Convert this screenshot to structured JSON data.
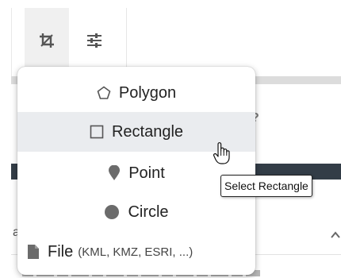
{
  "toolbar": {
    "buttons": [
      {
        "icon": "crop-icon"
      },
      {
        "icon": "sliders-icon"
      }
    ]
  },
  "menu": {
    "items": [
      {
        "label": "Polygon",
        "icon": "polygon-icon"
      },
      {
        "label": "Rectangle",
        "icon": "square-icon",
        "hovered": true
      },
      {
        "label": "Point",
        "icon": "map-pin-icon"
      },
      {
        "label": "Circle",
        "icon": "circle-icon"
      },
      {
        "label": "File",
        "sublabel": "(KML, KMZ, ESRI, ...)",
        "icon": "file-icon"
      }
    ]
  },
  "tooltip": {
    "text": "Select Rectangle"
  },
  "background": {
    "fragment_a": "a",
    "fragment_q": "?"
  },
  "colors": {
    "menu_hover": "#eaecef",
    "icon_gray": "#6b6b6b",
    "dark_strip": "#333d47"
  }
}
